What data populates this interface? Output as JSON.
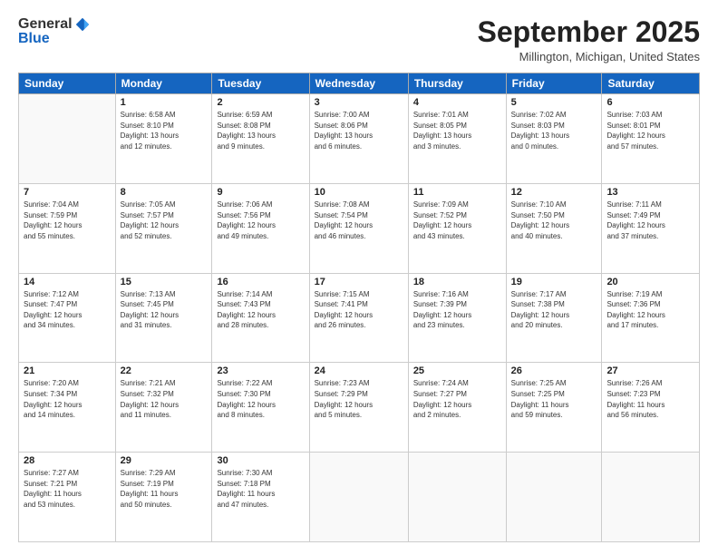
{
  "logo": {
    "general": "General",
    "blue": "Blue"
  },
  "header": {
    "month": "September 2025",
    "location": "Millington, Michigan, United States"
  },
  "weekdays": [
    "Sunday",
    "Monday",
    "Tuesday",
    "Wednesday",
    "Thursday",
    "Friday",
    "Saturday"
  ],
  "weeks": [
    [
      {
        "num": "",
        "info": ""
      },
      {
        "num": "1",
        "info": "Sunrise: 6:58 AM\nSunset: 8:10 PM\nDaylight: 13 hours\nand 12 minutes."
      },
      {
        "num": "2",
        "info": "Sunrise: 6:59 AM\nSunset: 8:08 PM\nDaylight: 13 hours\nand 9 minutes."
      },
      {
        "num": "3",
        "info": "Sunrise: 7:00 AM\nSunset: 8:06 PM\nDaylight: 13 hours\nand 6 minutes."
      },
      {
        "num": "4",
        "info": "Sunrise: 7:01 AM\nSunset: 8:05 PM\nDaylight: 13 hours\nand 3 minutes."
      },
      {
        "num": "5",
        "info": "Sunrise: 7:02 AM\nSunset: 8:03 PM\nDaylight: 13 hours\nand 0 minutes."
      },
      {
        "num": "6",
        "info": "Sunrise: 7:03 AM\nSunset: 8:01 PM\nDaylight: 12 hours\nand 57 minutes."
      }
    ],
    [
      {
        "num": "7",
        "info": "Sunrise: 7:04 AM\nSunset: 7:59 PM\nDaylight: 12 hours\nand 55 minutes."
      },
      {
        "num": "8",
        "info": "Sunrise: 7:05 AM\nSunset: 7:57 PM\nDaylight: 12 hours\nand 52 minutes."
      },
      {
        "num": "9",
        "info": "Sunrise: 7:06 AM\nSunset: 7:56 PM\nDaylight: 12 hours\nand 49 minutes."
      },
      {
        "num": "10",
        "info": "Sunrise: 7:08 AM\nSunset: 7:54 PM\nDaylight: 12 hours\nand 46 minutes."
      },
      {
        "num": "11",
        "info": "Sunrise: 7:09 AM\nSunset: 7:52 PM\nDaylight: 12 hours\nand 43 minutes."
      },
      {
        "num": "12",
        "info": "Sunrise: 7:10 AM\nSunset: 7:50 PM\nDaylight: 12 hours\nand 40 minutes."
      },
      {
        "num": "13",
        "info": "Sunrise: 7:11 AM\nSunset: 7:49 PM\nDaylight: 12 hours\nand 37 minutes."
      }
    ],
    [
      {
        "num": "14",
        "info": "Sunrise: 7:12 AM\nSunset: 7:47 PM\nDaylight: 12 hours\nand 34 minutes."
      },
      {
        "num": "15",
        "info": "Sunrise: 7:13 AM\nSunset: 7:45 PM\nDaylight: 12 hours\nand 31 minutes."
      },
      {
        "num": "16",
        "info": "Sunrise: 7:14 AM\nSunset: 7:43 PM\nDaylight: 12 hours\nand 28 minutes."
      },
      {
        "num": "17",
        "info": "Sunrise: 7:15 AM\nSunset: 7:41 PM\nDaylight: 12 hours\nand 26 minutes."
      },
      {
        "num": "18",
        "info": "Sunrise: 7:16 AM\nSunset: 7:39 PM\nDaylight: 12 hours\nand 23 minutes."
      },
      {
        "num": "19",
        "info": "Sunrise: 7:17 AM\nSunset: 7:38 PM\nDaylight: 12 hours\nand 20 minutes."
      },
      {
        "num": "20",
        "info": "Sunrise: 7:19 AM\nSunset: 7:36 PM\nDaylight: 12 hours\nand 17 minutes."
      }
    ],
    [
      {
        "num": "21",
        "info": "Sunrise: 7:20 AM\nSunset: 7:34 PM\nDaylight: 12 hours\nand 14 minutes."
      },
      {
        "num": "22",
        "info": "Sunrise: 7:21 AM\nSunset: 7:32 PM\nDaylight: 12 hours\nand 11 minutes."
      },
      {
        "num": "23",
        "info": "Sunrise: 7:22 AM\nSunset: 7:30 PM\nDaylight: 12 hours\nand 8 minutes."
      },
      {
        "num": "24",
        "info": "Sunrise: 7:23 AM\nSunset: 7:29 PM\nDaylight: 12 hours\nand 5 minutes."
      },
      {
        "num": "25",
        "info": "Sunrise: 7:24 AM\nSunset: 7:27 PM\nDaylight: 12 hours\nand 2 minutes."
      },
      {
        "num": "26",
        "info": "Sunrise: 7:25 AM\nSunset: 7:25 PM\nDaylight: 11 hours\nand 59 minutes."
      },
      {
        "num": "27",
        "info": "Sunrise: 7:26 AM\nSunset: 7:23 PM\nDaylight: 11 hours\nand 56 minutes."
      }
    ],
    [
      {
        "num": "28",
        "info": "Sunrise: 7:27 AM\nSunset: 7:21 PM\nDaylight: 11 hours\nand 53 minutes."
      },
      {
        "num": "29",
        "info": "Sunrise: 7:29 AM\nSunset: 7:19 PM\nDaylight: 11 hours\nand 50 minutes."
      },
      {
        "num": "30",
        "info": "Sunrise: 7:30 AM\nSunset: 7:18 PM\nDaylight: 11 hours\nand 47 minutes."
      },
      {
        "num": "",
        "info": ""
      },
      {
        "num": "",
        "info": ""
      },
      {
        "num": "",
        "info": ""
      },
      {
        "num": "",
        "info": ""
      }
    ]
  ]
}
